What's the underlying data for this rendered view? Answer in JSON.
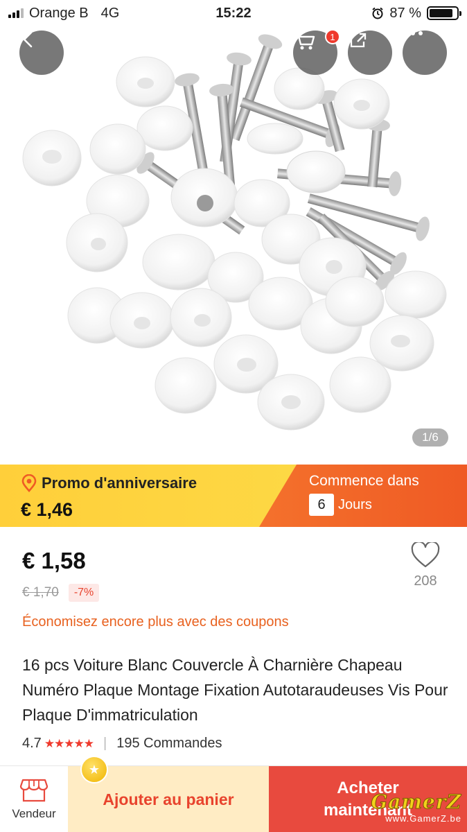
{
  "status_bar": {
    "carrier": "Orange B",
    "network": "4G",
    "time": "15:22",
    "battery": "87 %",
    "battery_level": 0.87
  },
  "gallery": {
    "page_indicator": "1/6",
    "cart_badge": "1"
  },
  "promo": {
    "title": "Promo d'anniversaire",
    "price": "€ 1,46",
    "starts_label": "Commence dans",
    "days_value": "6",
    "days_unit": "Jours"
  },
  "product": {
    "price": "€ 1,58",
    "old_price": "€ 1,70",
    "discount": "-7%",
    "coupon_text": "Économisez encore plus avec des coupons",
    "wishlist_count": "208",
    "title": "16 pcs Voiture Blanc Couvercle À Charnière Chapeau Numéro Plaque Montage Fixation Autotaraudeuses Vis Pour Plaque D'immatriculation",
    "rating": "4.7",
    "stars_value": 4.7,
    "orders": "195 Commandes"
  },
  "bottom_bar": {
    "vendor_label": "Vendeur",
    "add_to_cart": "Ajouter au panier",
    "buy_now_line1": "Acheter",
    "buy_now_line2": "maintenant"
  },
  "watermark": {
    "logo": "GamerZ",
    "url": "www.GamerZ.be"
  },
  "icons": [
    "back-icon",
    "cart-icon",
    "share-icon",
    "more-icon",
    "location-pin-icon",
    "heart-icon",
    "store-icon",
    "coin-icon"
  ],
  "colors": {
    "promo_yellow": "#ffcf3a",
    "promo_orange": "#ef5a24",
    "accent_red": "#e84a3e",
    "coupon_orange": "#e8611f"
  }
}
